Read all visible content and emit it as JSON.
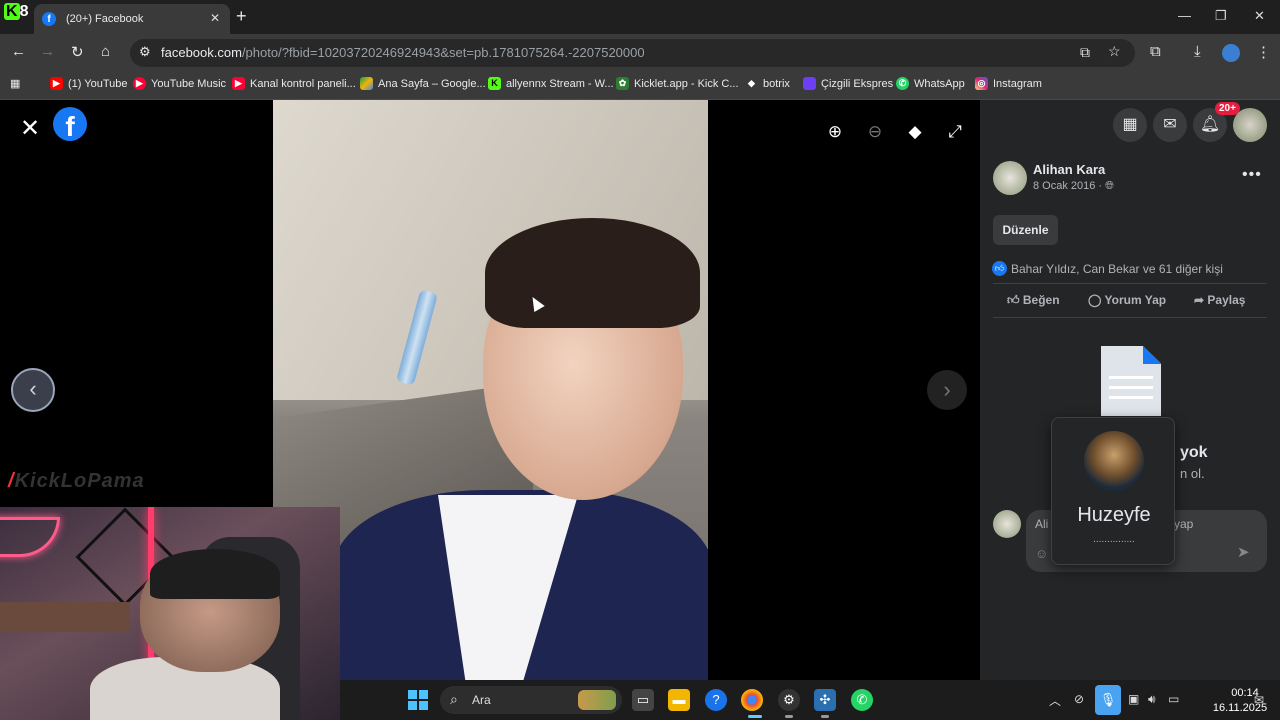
{
  "browser": {
    "tab_title": "(20+) Facebook",
    "tab_close": "✕",
    "new_tab": "+",
    "window_controls": {
      "minimize": "—",
      "maximize": "❐",
      "close": "✕"
    },
    "url_host": "facebook.com",
    "url_path": "/photo/?fbid=10203720246924943&set=pb.1781075264.-2207520000",
    "bookmarks": [
      {
        "label": "(1) YouTube",
        "icon": "youtube-icon",
        "color": "#ff0000"
      },
      {
        "label": "YouTube Music",
        "icon": "youtube-music-icon",
        "color": "#ff0033"
      },
      {
        "label": "Kanal kontrol paneli...",
        "icon": "youtube-studio-icon",
        "color": "#ff0033"
      },
      {
        "label": "Ana Sayfa – Google...",
        "icon": "google-drive-icon",
        "color": "#f4b400"
      },
      {
        "label": "allyennx Stream - W...",
        "icon": "kick-icon",
        "color": "#53fc18"
      },
      {
        "label": "Kicklet.app - Kick C...",
        "icon": "kicklet-icon",
        "color": "#2e7d32"
      },
      {
        "label": "botrix",
        "icon": "botrix-icon",
        "color": "#ffffff"
      },
      {
        "label": "Çizgili Ekspres",
        "icon": "cizgili-ekspres-icon",
        "color": "#6c3ff5"
      },
      {
        "label": "WhatsApp",
        "icon": "whatsapp-icon",
        "color": "#25d366"
      },
      {
        "label": "Instagram",
        "icon": "instagram-icon",
        "color": "#e1306c"
      }
    ]
  },
  "viewer": {
    "watermark": "KickLoPama",
    "prev_label": "‹",
    "next_label": "›"
  },
  "sidebar": {
    "notification_badge": "20+",
    "poster_name": "Alihan Kara",
    "post_date": "8 Ocak 2016 · ",
    "edit_button": "Düzenle",
    "likes_summary": "Bahar Yıldız, Can Bekar ve 61 diğer kişi",
    "actions": {
      "like": "Beğen",
      "comment": "Yorum Yap",
      "share": "Paylaş"
    },
    "no_comments_title": "yok",
    "no_comments_sub": "n ol.",
    "comment_placeholder_start": "Ali",
    "comment_placeholder_end": "yap"
  },
  "popup": {
    "name": "Huzeyfe",
    "status": "..............."
  },
  "taskbar": {
    "search_placeholder": "Ara",
    "time": "00:14",
    "date": "16.11.2025"
  },
  "colors": {
    "facebook_blue": "#1877f2",
    "sidebar_bg": "#242526",
    "badge_red": "#e41e3f"
  }
}
